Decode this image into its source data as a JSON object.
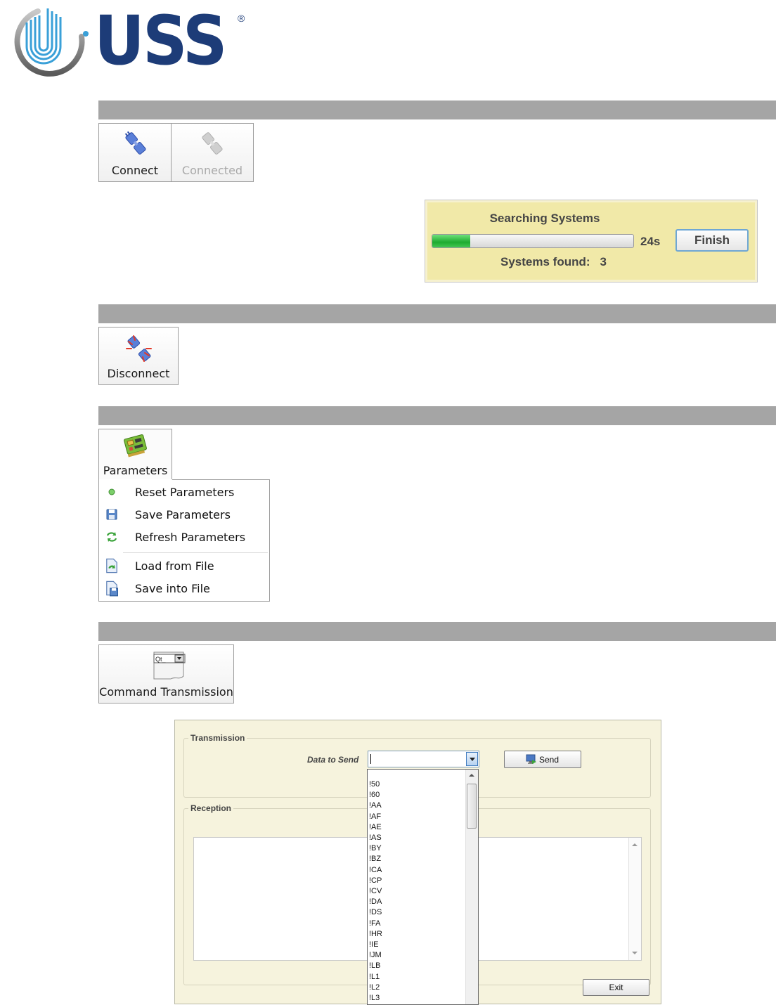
{
  "logo": {
    "text": "USS",
    "registered": "®"
  },
  "connect": {
    "connect_label": "Connect",
    "connected_label": "Connected"
  },
  "search_dialog": {
    "title": "Searching Systems",
    "progress_fraction": 0.19,
    "seconds": "24s",
    "finish_label": "Finish",
    "found_label": "Systems found:",
    "found_count": "3"
  },
  "disconnect": {
    "label": "Disconnect"
  },
  "parameters": {
    "label": "Parameters",
    "menu": [
      {
        "label": "Reset Parameters",
        "icon": "green-dot-icon"
      },
      {
        "label": "Save Parameters",
        "icon": "floppy-icon"
      },
      {
        "label": "Refresh Parameters",
        "icon": "refresh-icon"
      },
      {
        "label": "Load from File",
        "icon": "load-file-icon"
      },
      {
        "label": "Save into File",
        "icon": "save-file-icon"
      }
    ]
  },
  "command": {
    "label": "Command Transmission",
    "icon_text": "Qt_"
  },
  "transmission_dialog": {
    "transmission_group": "Transmission",
    "data_to_send_label": "Data to Send",
    "send_label": "Send",
    "reception_group": "Reception",
    "exit_label": "Exit",
    "dropdown_options": [
      "!50",
      "!60",
      "!AA",
      "!AF",
      "!AE",
      "!AS",
      "!BY",
      "!BZ",
      "!CA",
      "!CP",
      "!CV",
      "!DA",
      "!DS",
      "!FA",
      "!HR",
      "!IE",
      "!JM",
      "!LB",
      "!L1",
      "!L2",
      "!L3"
    ]
  },
  "colors": {
    "brand": "#1d3c78",
    "section_bar": "#a5a5a5",
    "panel_yellow": "#f1e9a8",
    "dialog_bg": "#f6f3dd",
    "progress_green": "#1dab2f"
  }
}
